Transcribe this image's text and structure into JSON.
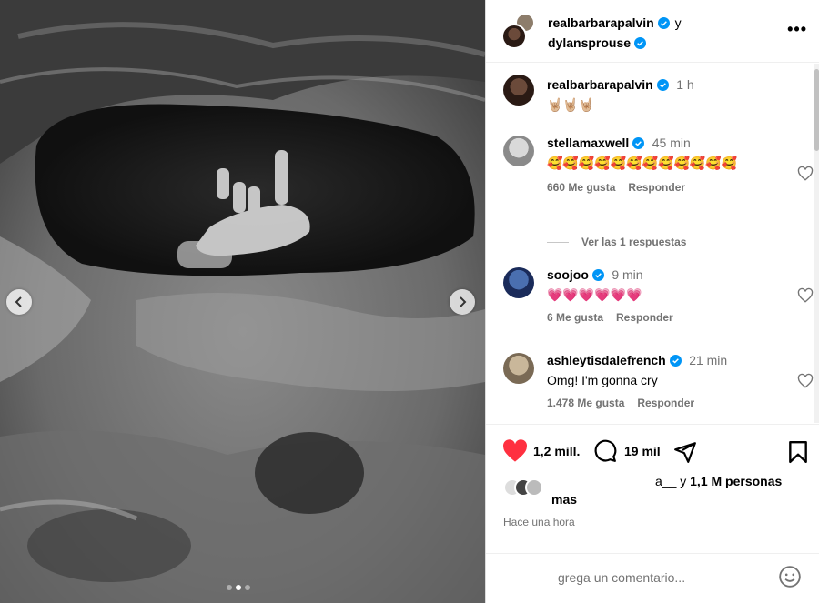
{
  "header": {
    "user1": "realbarbarapalvin",
    "conjunction": "y",
    "user2": "dylansprouse"
  },
  "caption": {
    "username": "realbarbarapalvin",
    "time": "1 h",
    "text": "🤘🏼🤘🏼🤘🏼"
  },
  "comments": [
    {
      "username": "stellamaxwell",
      "time": "45 min",
      "text": "🥰🥰🥰🥰🥰🥰🥰🥰🥰🥰🥰🥰",
      "likes": "660 Me gusta",
      "reply": "Responder"
    },
    {
      "username": "soojoo",
      "time": "9 min",
      "text": "💗💗💗💗💗💗",
      "likes": "6 Me gusta",
      "reply": "Responder"
    },
    {
      "username": "ashleytisdalefrench",
      "time": "21 min",
      "text": "Omg! I'm gonna cry",
      "likes": "1.478 Me gusta",
      "reply": "Responder"
    }
  ],
  "view_replies": "Ver las 1 respuestas",
  "actions": {
    "like_count": "1,2 mill.",
    "comment_count": "19 mil"
  },
  "likes_summary": {
    "prefix": "a__ y ",
    "count": "1,1 M personas",
    "suffix": "mas"
  },
  "posted": "Hace una hora",
  "add_comment_placeholder": "grega un comentario...",
  "colors": {
    "like_red": "#ff3040",
    "verified_blue": "#0095f6",
    "muted_text": "#737373"
  }
}
